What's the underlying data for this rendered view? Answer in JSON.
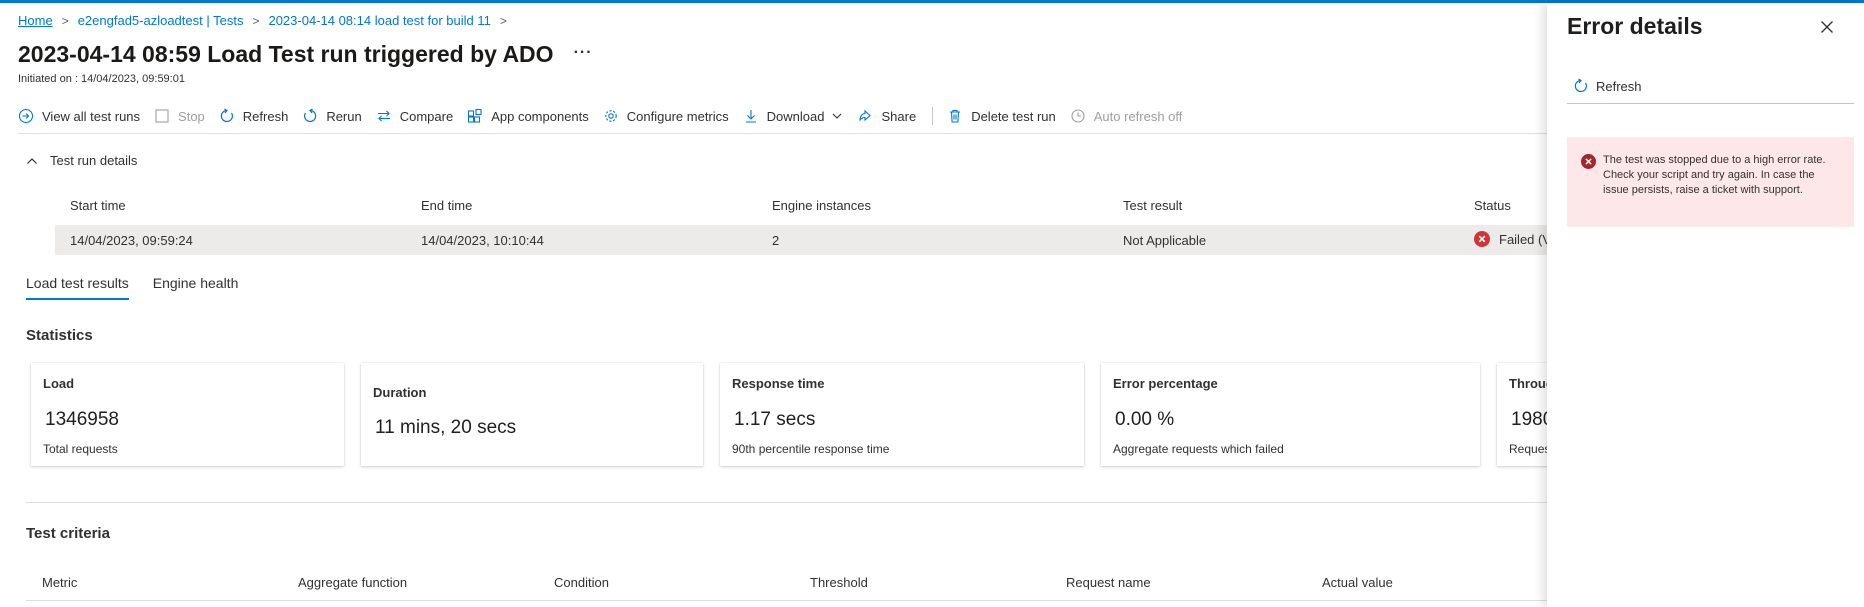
{
  "breadcrumb": {
    "home": "Home",
    "resource": "e2engfad5-azloadtest | Tests",
    "test": "2023-04-14 08:14 load test for build 11"
  },
  "page": {
    "title": "2023-04-14 08:59 Load Test run triggered by ADO",
    "more": "···",
    "initiated": "Initiated on : 14/04/2023, 09:59:01"
  },
  "toolbar": {
    "view_all": "View all test runs",
    "stop": "Stop",
    "refresh": "Refresh",
    "rerun": "Rerun",
    "compare": "Compare",
    "app_components": "App components",
    "configure_metrics": "Configure metrics",
    "download": "Download",
    "share": "Share",
    "delete": "Delete test run",
    "auto_refresh": "Auto refresh off"
  },
  "details": {
    "toggle_label": "Test run details",
    "headers": [
      "Start time",
      "End time",
      "Engine instances",
      "Test result",
      "Status"
    ],
    "row": {
      "start": "14/04/2023, 09:59:24",
      "end": "14/04/2023, 10:10:44",
      "engines": "2",
      "result": "Not Applicable",
      "status": "Failed (V"
    }
  },
  "tabs": [
    {
      "label": "Load test results",
      "active": true
    },
    {
      "label": "Engine health",
      "active": false
    }
  ],
  "statistics": {
    "title": "Statistics",
    "cards": [
      {
        "title": "Load",
        "value": "1346958",
        "sub": "Total requests"
      },
      {
        "title": "Duration",
        "value": "11 mins, 20 secs",
        "sub": ""
      },
      {
        "title": "Response time",
        "value": "1.17 secs",
        "sub": "90th percentile response time"
      },
      {
        "title": "Error percentage",
        "value": "0.00 %",
        "sub": "Aggregate requests which failed"
      },
      {
        "title": "Throug",
        "value": "1980",
        "sub": "Reques"
      }
    ]
  },
  "criteria": {
    "title": "Test criteria",
    "headers": [
      "Metric",
      "Aggregate function",
      "Condition",
      "Threshold",
      "Request name",
      "Actual value"
    ]
  },
  "panel": {
    "title": "Error details",
    "refresh": "Refresh",
    "error_message": "The test was stopped due to a high error rate. Check your script and try again. In case the issue persists, raise a ticket with support."
  },
  "colors": {
    "accent": "#0078d4",
    "error": "#a4262c",
    "error_bg": "#fde7e9",
    "row_bg": "#edebe9"
  }
}
